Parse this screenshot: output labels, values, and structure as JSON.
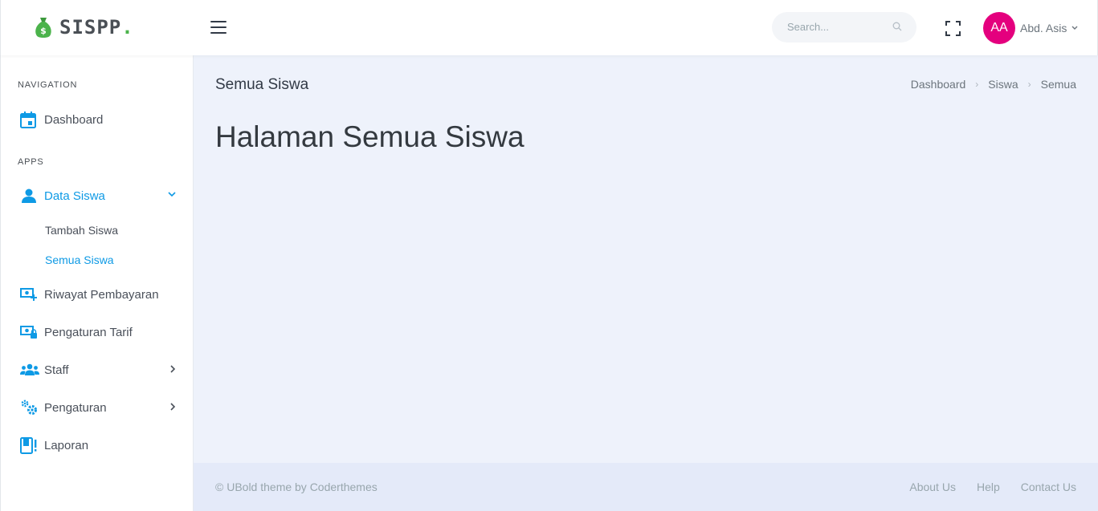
{
  "brand": {
    "name": "SISPP",
    "dot": ".",
    "logo_icon": "money-bag-icon",
    "accent": "#4bb34b"
  },
  "topbar": {
    "menu_icon": "hamburger-icon",
    "search_placeholder": "Search...",
    "search_icon": "search-icon",
    "fullscreen_icon": "fullscreen-icon",
    "user": {
      "initials": "AA",
      "name": "Abd. Asis",
      "avatar_color": "#e4007e",
      "caret_icon": "chevron-down-icon"
    }
  },
  "sidebar": {
    "section_navigation": "NAVIGATION",
    "section_apps": "APPS",
    "active_color": "#0e9ae5",
    "items": [
      {
        "label": "Dashboard",
        "icon": "calendar-icon"
      },
      {
        "label": "Data Siswa",
        "icon": "user-icon",
        "expanded": true,
        "active": true
      },
      {
        "label": "Riwayat Pembayaran",
        "icon": "cash-plus-icon"
      },
      {
        "label": "Pengaturan Tarif",
        "icon": "cash-lock-icon"
      },
      {
        "label": "Staff",
        "icon": "users-icon",
        "has_children": true
      },
      {
        "label": "Pengaturan",
        "icon": "cogs-icon",
        "has_children": true
      },
      {
        "label": "Laporan",
        "icon": "book-alert-icon"
      }
    ],
    "sub_items": [
      {
        "label": "Tambah Siswa"
      },
      {
        "label": "Semua Siswa",
        "active": true
      }
    ]
  },
  "page": {
    "title": "Semua Siswa",
    "heading": "Halaman Semua Siswa",
    "breadcrumb": [
      "Dashboard",
      "Siswa",
      "Semua"
    ]
  },
  "footer": {
    "copyright": "© UBold theme by Coderthemes",
    "links": [
      "About Us",
      "Help",
      "Contact Us"
    ]
  }
}
